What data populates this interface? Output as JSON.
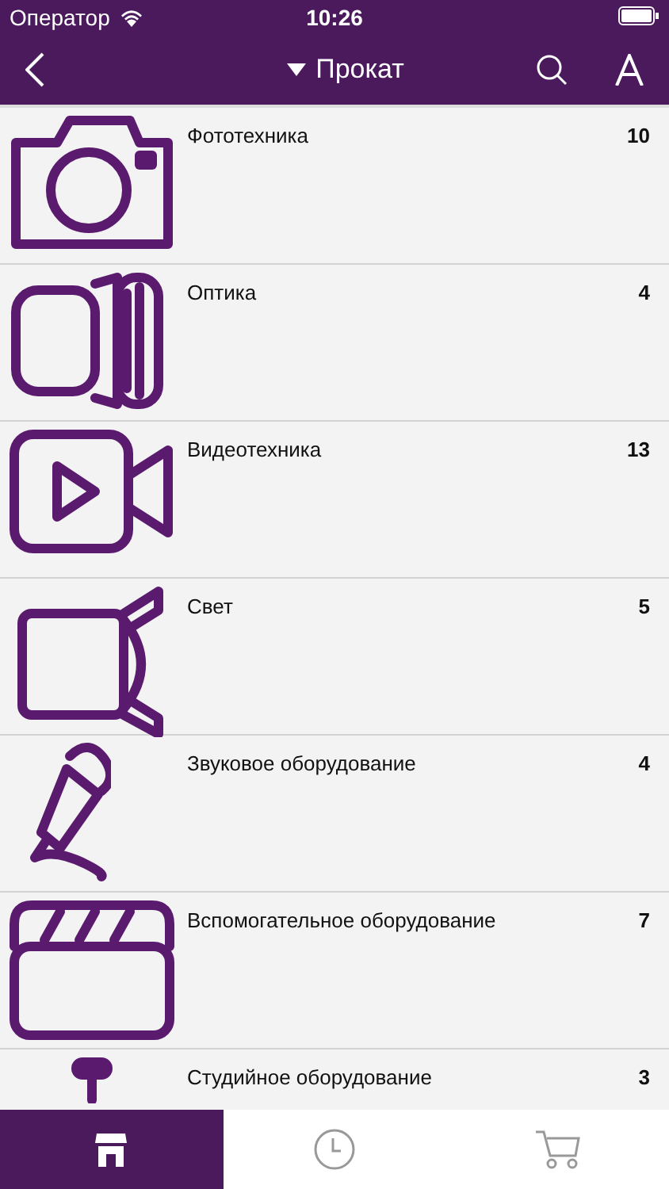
{
  "status_bar": {
    "carrier": "Оператор",
    "time": "10:26"
  },
  "nav": {
    "title": "Прокат"
  },
  "categories": [
    {
      "kind": "camera",
      "name": "Фототехника",
      "count": "10"
    },
    {
      "kind": "lens",
      "name": "Оптика",
      "count": "4"
    },
    {
      "kind": "video",
      "name": "Видеотехника",
      "count": "13"
    },
    {
      "kind": "light",
      "name": "Свет",
      "count": "5"
    },
    {
      "kind": "mic",
      "name": "Звуковое оборудование",
      "count": "4"
    },
    {
      "kind": "clapper",
      "name": "Вспомогательное оборудование",
      "count": "7"
    },
    {
      "kind": "studio",
      "name": "Студийное оборудование",
      "count": "3"
    }
  ],
  "tab_bar": [
    {
      "kind": "shop",
      "selected": true
    },
    {
      "kind": "history",
      "selected": false
    },
    {
      "kind": "cart",
      "selected": false
    }
  ]
}
